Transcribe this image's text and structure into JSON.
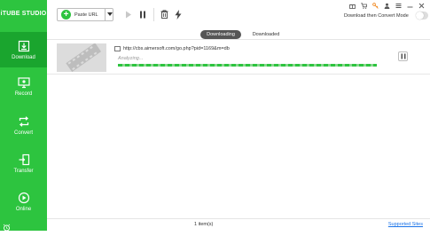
{
  "app": {
    "title": "iTUBE STUDIO"
  },
  "sidebar": {
    "items": [
      {
        "label": "Download",
        "icon": "download-icon",
        "active": true
      },
      {
        "label": "Record",
        "icon": "record-icon",
        "active": false
      },
      {
        "label": "Convert",
        "icon": "convert-icon",
        "active": false
      },
      {
        "label": "Transfer",
        "icon": "transfer-icon",
        "active": false
      },
      {
        "label": "Online",
        "icon": "online-icon",
        "active": false
      }
    ]
  },
  "toolbar": {
    "paste_url_label": "Paste URL",
    "convert_mode_label": "Download then Convert Mode",
    "convert_mode_on": false
  },
  "tabs": [
    {
      "label": "Downloading",
      "active": true
    },
    {
      "label": "Downloaded",
      "active": false
    }
  ],
  "downloads": [
    {
      "url": "http://cbs.aimersoft.com/go.php?pid=1169&m=db",
      "status": "Analyzing...",
      "progress": 1.0
    }
  ],
  "footer": {
    "count_text": "1 item(s)",
    "supported_sites_label": "Supported Sites"
  },
  "colors": {
    "sidebar": "#2dc43f",
    "sidebar_active": "#1aa52e",
    "link": "#1a73e8"
  }
}
